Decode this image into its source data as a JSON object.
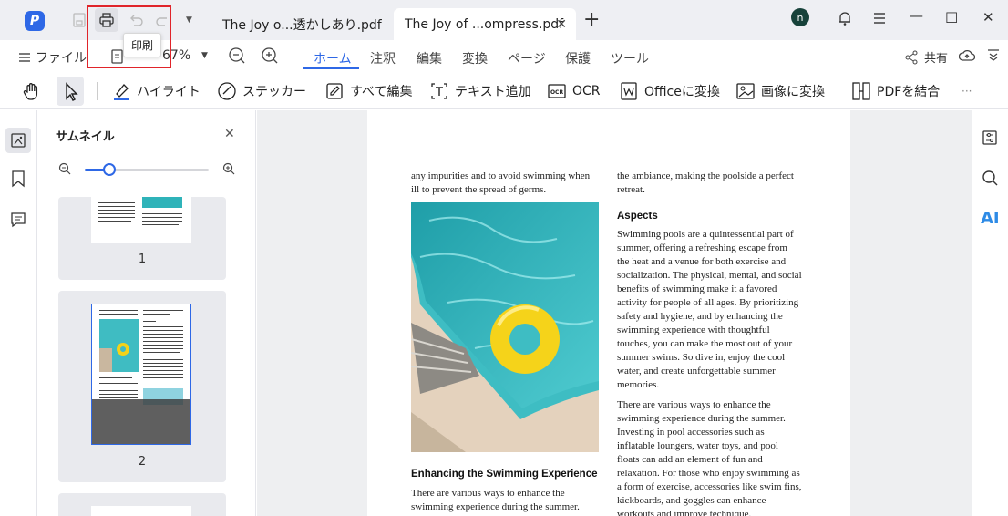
{
  "title_bar": {
    "tabs": [
      {
        "label": "The Joy o...透かしあり.pdf"
      },
      {
        "label": "The Joy of ...ompress.pdf",
        "close": "✕"
      }
    ],
    "new_tab": "+",
    "avatar": "n",
    "window_controls": {
      "minimize": "—",
      "maximize": "☐",
      "close": "✕"
    }
  },
  "tooltip": {
    "label": "印刷"
  },
  "menubar": {
    "file_label": "ファイル",
    "zoom_value": "67%",
    "tabs": [
      "ホーム",
      "注釈",
      "編集",
      "変換",
      "ページ",
      "保護",
      "ツール"
    ],
    "active_tab": "ホーム",
    "share_label": "共有"
  },
  "toolbar": {
    "highlight": "ハイライト",
    "sticker": "ステッカー",
    "edit_all": "すべて編集",
    "add_text": "テキスト追加",
    "ocr": "OCR",
    "to_office": "Officeに変換",
    "to_image": "画像に変換",
    "combine_pdf": "PDFを結合",
    "more": "···"
  },
  "sidepanel": {
    "title": "サムネイル",
    "close": "✕",
    "zoom_slider_level": 0.2,
    "pages": [
      "1",
      "2"
    ]
  },
  "document": {
    "col1_top": "any impurities and to avoid swimming when\nill to prevent the spread of germs.",
    "col1_heading": "Enhancing the Swimming Experience",
    "col1_bottom": "There are various ways to enhance the\nswimming experience during the summer.",
    "col2_top": "the ambiance, making the poolside a perfect\nretreat.",
    "col2_heading": "Aspects",
    "col2_p1": "Swimming pools are a quintessential part of\nsummer, offering a refreshing escape from\nthe heat and a venue for both exercise and\nsocialization. The physical, mental, and social\nbenefits of swimming make it a favored\nactivity for people of all ages. By prioritizing\nsafety and hygiene, and by enhancing the\nswimming experience with thoughtful\ntouches, you can make the most out of your\nsummer swims. So dive in, enjoy the cool\nwater, and create unforgettable summer\nmemories.",
    "col2_p2": "There are various ways to enhance the\nswimming experience during the summer.\nInvesting in pool accessories such as\ninflatable loungers, water toys, and pool\nfloats can add an element of fun and\nrelaxation. For those who enjoy swimming as\na form of exercise, accessories like swim fins,\nkickboards, and goggles can enhance\nworkouts and improve technique."
  },
  "right_rail": {
    "ai_label": "AI"
  },
  "colors": {
    "accent": "#2e68e6",
    "highlight_box": "#e0242a",
    "pool": "#3dbdc4",
    "ring": "#f5d31a"
  }
}
